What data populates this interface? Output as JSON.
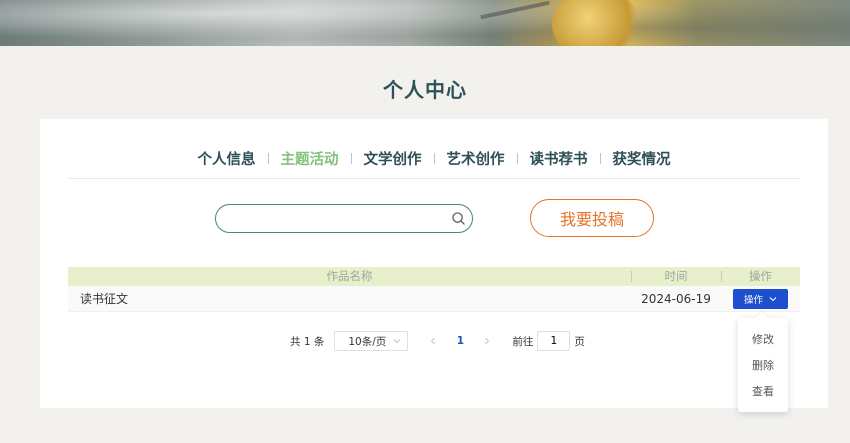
{
  "page": {
    "title": "个人中心"
  },
  "tabs": [
    {
      "label": "个人信息",
      "active": false
    },
    {
      "label": "主题活动",
      "active": true
    },
    {
      "label": "文学创作",
      "active": false
    },
    {
      "label": "艺术创作",
      "active": false
    },
    {
      "label": "读书荐书",
      "active": false
    },
    {
      "label": "获奖情况",
      "active": false
    }
  ],
  "search": {
    "value": "",
    "placeholder": "",
    "icon": "search-icon"
  },
  "submit_button": {
    "label": "我要投稿"
  },
  "table": {
    "headers": {
      "name": "作品名称",
      "time": "时间",
      "action": "操作"
    },
    "rows": [
      {
        "name": "读书征文",
        "time": "2024-06-19",
        "action_label": "操作"
      }
    ]
  },
  "dropdown": {
    "items": [
      "修改",
      "删除",
      "查看"
    ]
  },
  "pagination": {
    "total": "共 1 条",
    "page_size": "10条/页",
    "current_page": "1",
    "goto_prefix": "前往",
    "goto_value": "1",
    "goto_suffix": "页"
  },
  "colors": {
    "accent_teal": "#2d5158",
    "active_tab": "#83c27a",
    "submit_orange": "#e5732a",
    "primary_blue": "#1f4fd1",
    "table_header_bg": "#e7efcb"
  }
}
